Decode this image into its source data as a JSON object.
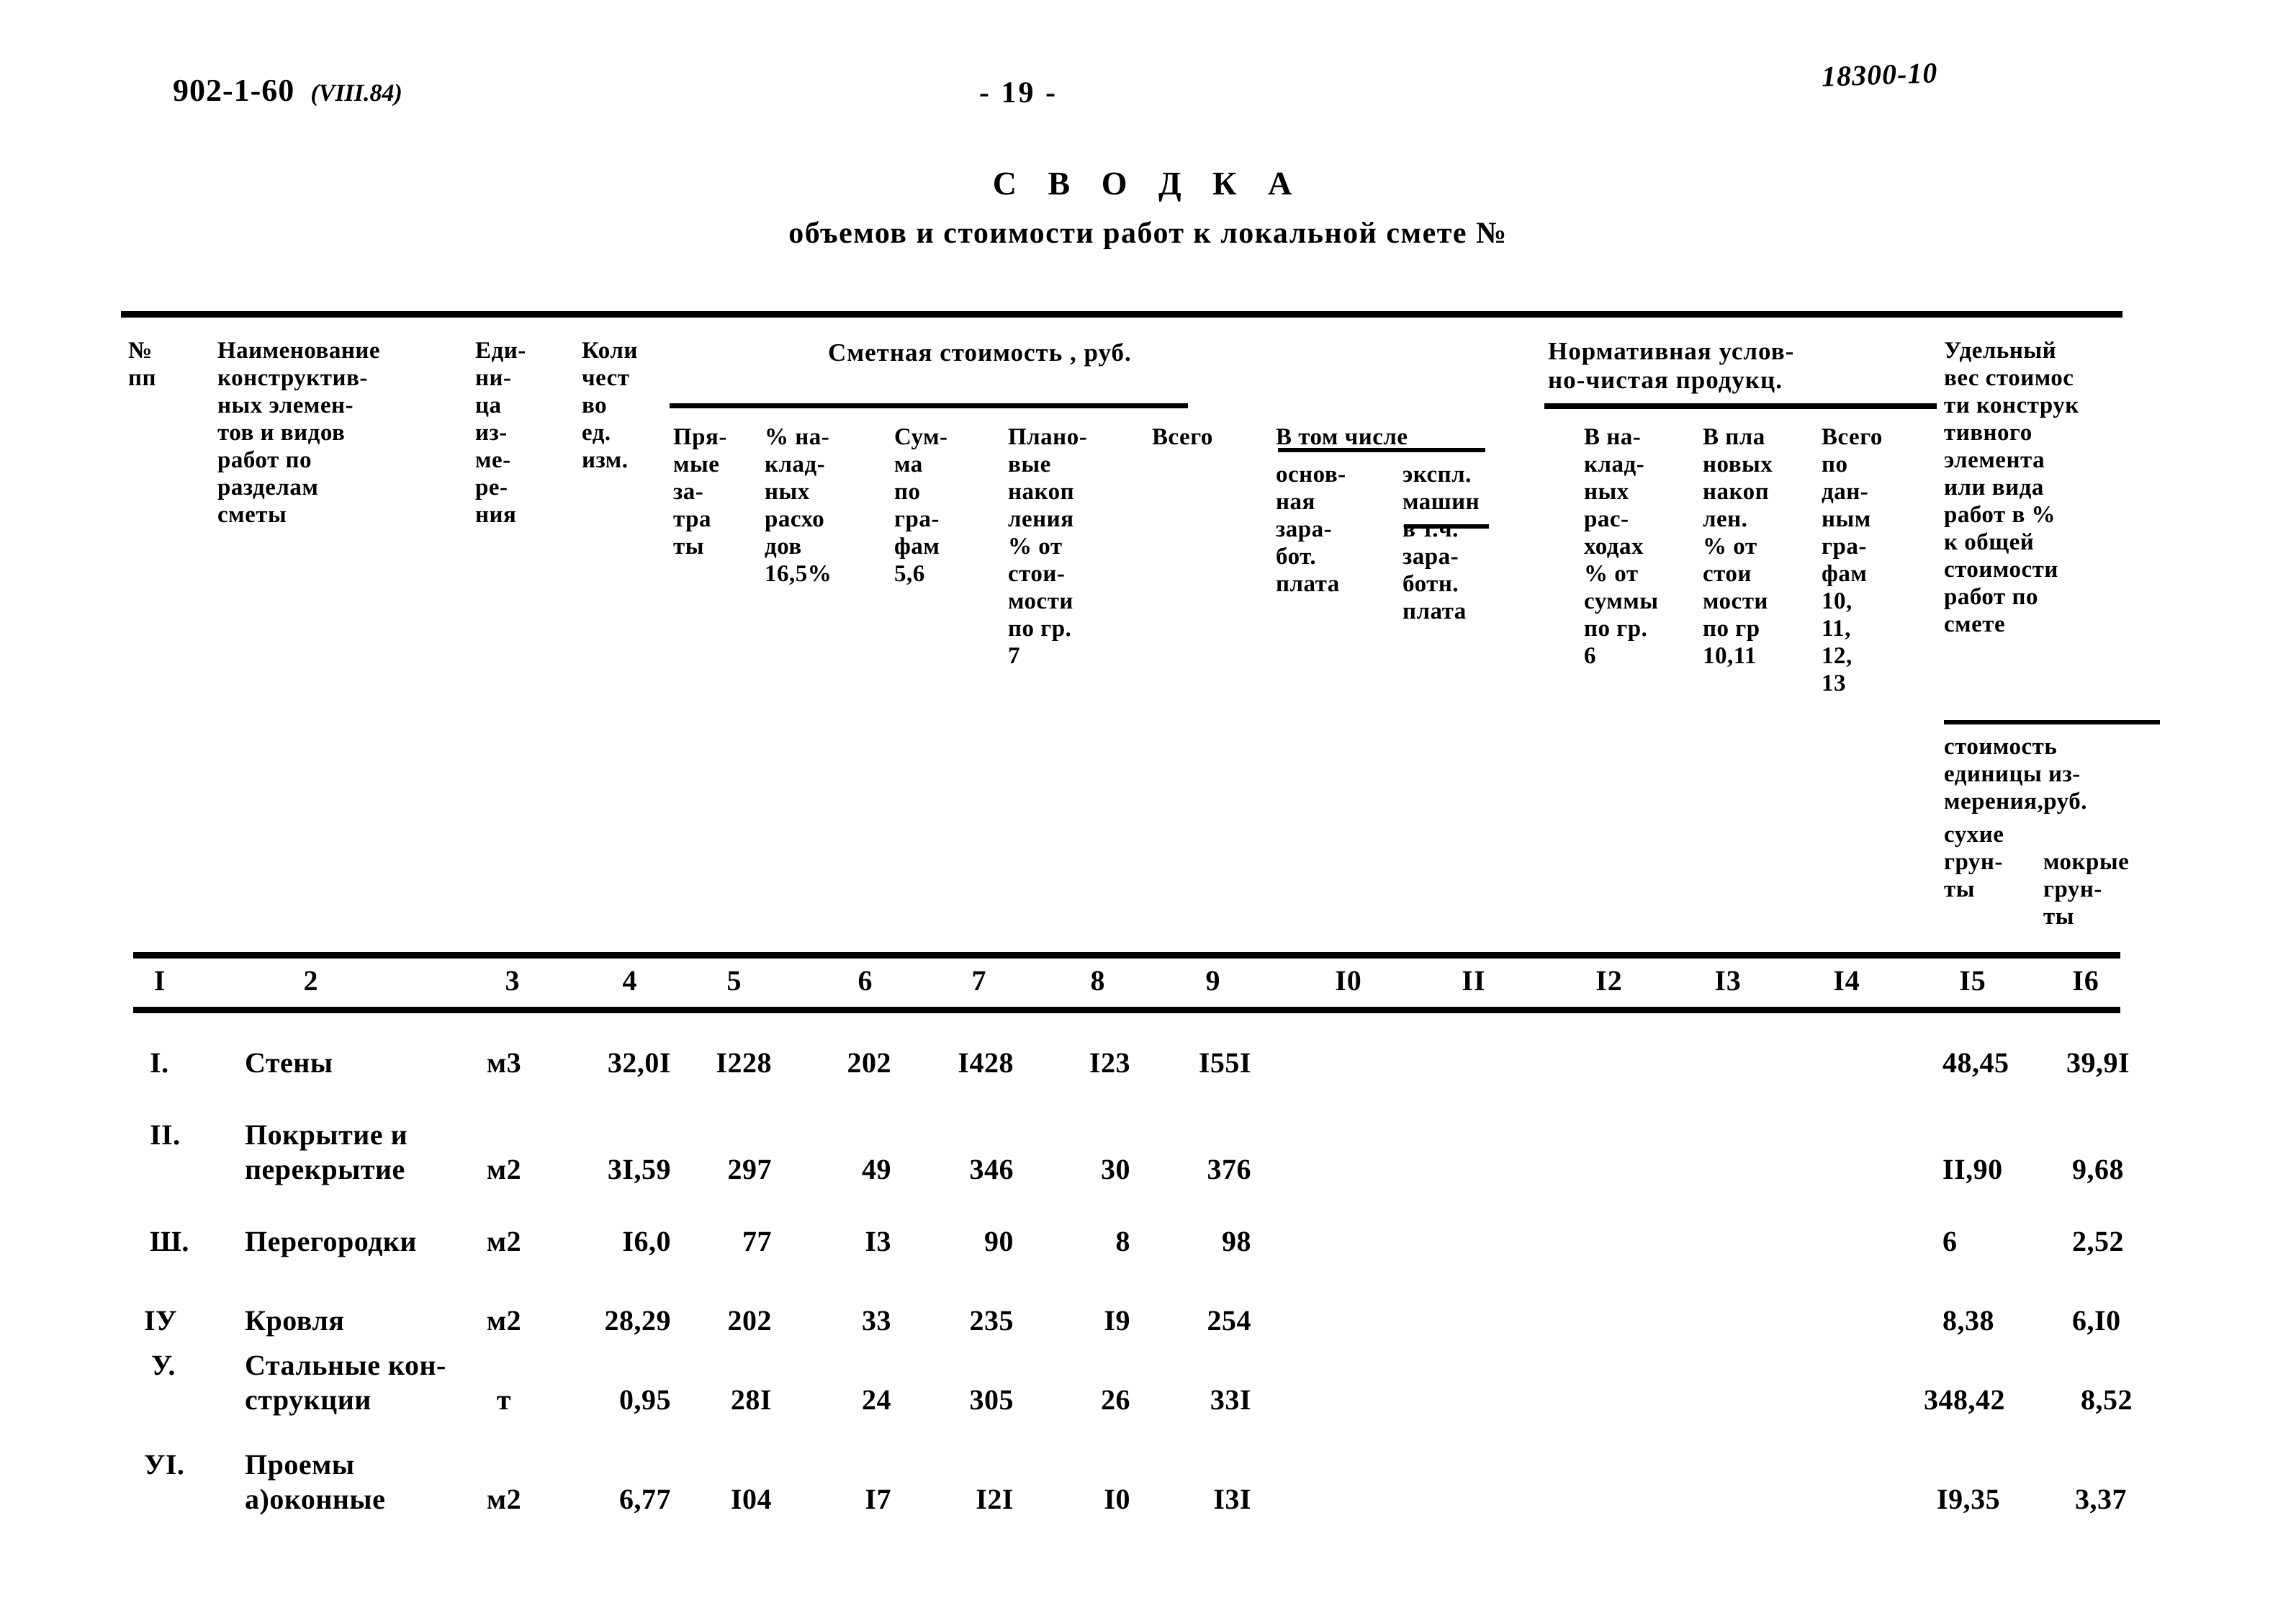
{
  "header": {
    "doc_code": "902-1-60",
    "doc_revision": "(VIII.84)",
    "page_number": "- 19 -",
    "stamp_code": "18300-10"
  },
  "title": {
    "main": "С В О Д К А",
    "subtitle": "объемов и стоимости работ к локальной смете №"
  },
  "table": {
    "group_headers": {
      "smetnaya": "Сметная стоимость , руб.",
      "normativnaya": "Нормативная услов-\nно-чистая продукц.",
      "v_tom_chisle": "В том числе"
    },
    "column_headers": {
      "c1": "№\nпп",
      "c2": "Наименование\nконструктив-\nных элемен-\nтов и видов\nработ по\nразделам\nсметы",
      "c3": "Еди-\nни-\nца\nиз-\nме-\nре-\nния",
      "c4": "Коли\nчест\nво\nед.\nизм.",
      "c5": "Пря-\nмые\nза-\nтра\nты",
      "c6": "% на-\nклад-\nных\nрасхо\nдов\n16,5%",
      "c7": "Сум-\nма\nпо\nгра-\nфам\n5,6",
      "c8": "Плано-\nвые\nнакоп\nления\n% от\nстои-\nмости\nпо гр.\n   7",
      "c9": "Всего",
      "c10": "основ-\nная\nзара-\nбот.\nплата",
      "c11": "экспл.\nмашин\nв т.ч.\nзара-\nботн.\nплата",
      "c12": "В на-\nклад-\nных\nрас-\nходах\n% от\nсуммы\nпо гр.\n    6",
      "c13": "В пла\nновых\nнакоп\nлен.\n% от\nстои\nмости\nпо гр\n10,11",
      "c14": "Всего\nпо\nдан-\nным\nгра-\nфам\n10,\n11,\n12,\n13",
      "c15_16_top": "Удельный\nвес стоимос\nти конструк\nтивного\nэлемента\nили вида\nработ в %\nк общей\nстоимости\nработ по\nсмете",
      "c15_16_sub": "стоимость\nединицы из-\nмерения,руб.",
      "c15": "сухие\nгрун-\nты",
      "c16": "мокрые\nгрун-\nты"
    },
    "column_numbers": [
      "I",
      "2",
      "3",
      "4",
      "5",
      "6",
      "7",
      "8",
      "9",
      "I0",
      "II",
      "I2",
      "I3",
      "I4",
      "I5",
      "I6"
    ],
    "rows": [
      {
        "no": "I.",
        "name_line1": "Стены",
        "name_line2": "",
        "unit": "м3",
        "qty": "32,0I",
        "direct": "I228",
        "overhead": "202",
        "sum56": "I428",
        "planned": "I23",
        "total": "I55I",
        "basic_wage": "",
        "machines": "",
        "nchp_overhead": "",
        "nchp_planned": "",
        "nchp_total": "",
        "unit_cost_dry": "48,45",
        "unit_cost_wet": "39,9I"
      },
      {
        "no": "II.",
        "name_line1": "Покрытие и",
        "name_line2": "перекрытие",
        "unit": "м2",
        "qty": "3I,59",
        "direct": "297",
        "overhead": "49",
        "sum56": "346",
        "planned": "30",
        "total": "376",
        "basic_wage": "",
        "machines": "",
        "nchp_overhead": "",
        "nchp_planned": "",
        "nchp_total": "",
        "unit_cost_dry": "II,90",
        "unit_cost_wet": "9,68"
      },
      {
        "no": "Ш.",
        "name_line1": "Перегородки",
        "name_line2": "",
        "unit": "м2",
        "qty": "I6,0",
        "direct": "77",
        "overhead": "I3",
        "sum56": "90",
        "planned": "8",
        "total": "98",
        "basic_wage": "",
        "machines": "",
        "nchp_overhead": "",
        "nchp_planned": "",
        "nchp_total": "",
        "unit_cost_dry": "6",
        "unit_cost_wet": "2,52"
      },
      {
        "no": "IУ",
        "name_line1": "Кровля",
        "name_line2": "",
        "unit": "м2",
        "qty": "28,29",
        "direct": "202",
        "overhead": "33",
        "sum56": "235",
        "planned": "I9",
        "total": "254",
        "basic_wage": "",
        "machines": "",
        "nchp_overhead": "",
        "nchp_planned": "",
        "nchp_total": "",
        "unit_cost_dry": "8,38",
        "unit_cost_wet": "6,I0"
      },
      {
        "no": "У.",
        "name_line1": "Стальные кон-",
        "name_line2": "струкции",
        "unit": "т",
        "qty": "0,95",
        "direct": "28I",
        "overhead": "24",
        "sum56": "305",
        "planned": "26",
        "total": "33I",
        "basic_wage": "",
        "machines": "",
        "nchp_overhead": "",
        "nchp_planned": "",
        "nchp_total": "",
        "unit_cost_dry": "348,42",
        "unit_cost_wet": "8,52"
      },
      {
        "no": "УI.",
        "name_line1": "Проемы",
        "name_line2": "а)оконные",
        "unit": "м2",
        "qty": "6,77",
        "direct": "I04",
        "overhead": "I7",
        "sum56": "I2I",
        "planned": "I0",
        "total": "I3I",
        "basic_wage": "",
        "machines": "",
        "nchp_overhead": "",
        "nchp_planned": "",
        "nchp_total": "",
        "unit_cost_dry": "I9,35",
        "unit_cost_wet": "3,37"
      }
    ]
  }
}
